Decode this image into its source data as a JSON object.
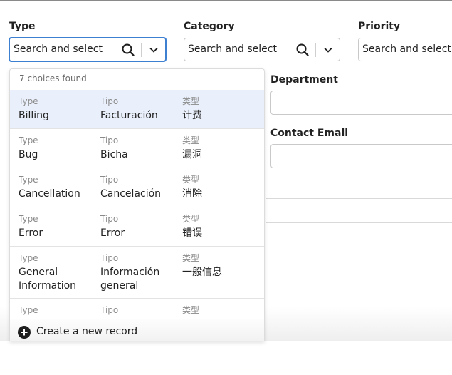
{
  "fields": {
    "type": {
      "label": "Type",
      "placeholder": "Search and select"
    },
    "category": {
      "label": "Category",
      "placeholder": "Search and select"
    },
    "priority": {
      "label": "Priority",
      "placeholder": "Search and select"
    },
    "department": {
      "label": "Department"
    },
    "contact_email": {
      "label": "Contact Email"
    }
  },
  "dropdown": {
    "count_text": "7 choices found",
    "headers": [
      "Type",
      "Tipo",
      "类型"
    ],
    "options": [
      {
        "en": "Billing",
        "es": "Facturación",
        "zh": "计费",
        "selected": true
      },
      {
        "en": "Bug",
        "es": "Bicha",
        "zh": "漏洞"
      },
      {
        "en": "Cancellation",
        "es": "Cancelación",
        "zh": "消除"
      },
      {
        "en": "Error",
        "es": "Error",
        "zh": "错误"
      },
      {
        "en": "General Information",
        "es": "Información general",
        "zh": "一般信息"
      },
      {
        "en": "",
        "es": "",
        "zh": ""
      }
    ],
    "create_label": "Create a new record"
  },
  "icons": {
    "search": "search-icon",
    "chevron": "chevron-down-icon",
    "add": "plus-circle-icon"
  },
  "colors": {
    "focus_border": "#3d7fd1",
    "selected_row": "#eaf0fb"
  }
}
